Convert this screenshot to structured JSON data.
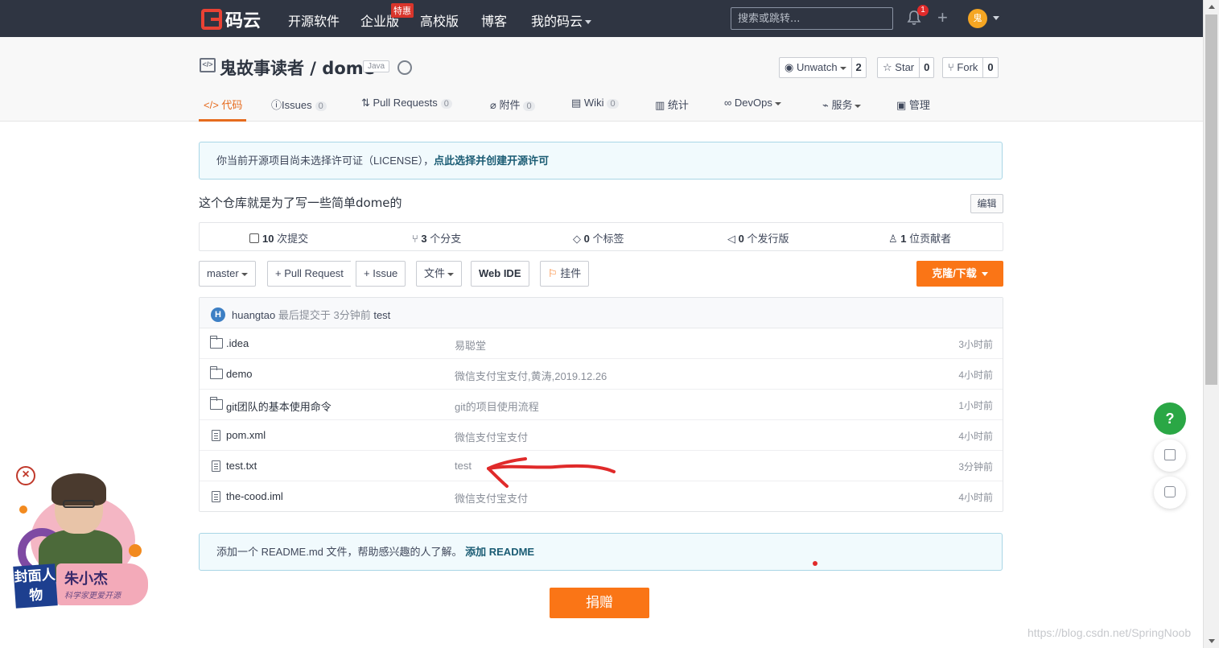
{
  "topbar": {
    "logo_text": "码云",
    "nav": [
      "开源软件",
      "企业版",
      "高校版",
      "博客",
      "我的码云"
    ],
    "promo_badge": "特惠",
    "search_placeholder": "搜索或跳转...",
    "notification_count": "1",
    "avatar_text": "鬼"
  },
  "project": {
    "title": "鬼故事读者 / dome",
    "language": "Java",
    "watch": {
      "label": "Unwatch",
      "count": "2"
    },
    "star": {
      "label": "Star",
      "count": "0"
    },
    "fork": {
      "label": "Fork",
      "count": "0"
    }
  },
  "tabs": [
    {
      "label": "代码",
      "badge": ""
    },
    {
      "label": "Issues",
      "badge": "0"
    },
    {
      "label": "Pull Requests",
      "badge": "0"
    },
    {
      "label": "附件",
      "badge": "0"
    },
    {
      "label": "Wiki",
      "badge": "0"
    },
    {
      "label": "统计",
      "badge": ""
    },
    {
      "label": "DevOps",
      "badge": ""
    },
    {
      "label": "服务",
      "badge": ""
    },
    {
      "label": "管理",
      "badge": ""
    }
  ],
  "license_notice": {
    "text": "你当前开源项目尚未选择许可证（LICENSE），",
    "link": "点此选择并创建开源许可"
  },
  "description": "这个仓库就是为了写一些简单dome的",
  "edit_label": "编辑",
  "stats": [
    {
      "count": "10",
      "label": "次提交"
    },
    {
      "count": "3",
      "label": "个分支"
    },
    {
      "count": "0",
      "label": "个标签"
    },
    {
      "count": "0",
      "label": "个发行版"
    },
    {
      "count": "1",
      "label": "位贡献者"
    }
  ],
  "actions": {
    "branch": "master",
    "pull_request": "+ Pull Request",
    "issue": "+ Issue",
    "file": "文件",
    "web_ide": "Web IDE",
    "widget": "挂件",
    "clone": "克隆/下载"
  },
  "latest_commit": {
    "avatar": "H",
    "author": "huangtao",
    "text": "最后提交于 3分钟前",
    "message": "test"
  },
  "files": [
    {
      "type": "folder",
      "name": ".idea",
      "message": "易聪堂",
      "time": "3小时前"
    },
    {
      "type": "folder",
      "name": "demo",
      "message": "微信支付宝支付,黄涛,2019.12.26",
      "time": "4小时前"
    },
    {
      "type": "folder",
      "name": "git团队的基本使用命令",
      "message": "git的项目使用流程",
      "time": "1小时前"
    },
    {
      "type": "file",
      "name": "pom.xml",
      "message": "微信支付宝支付",
      "time": "4小时前"
    },
    {
      "type": "file",
      "name": "test.txt",
      "message": "test",
      "time": "3分钟前"
    },
    {
      "type": "file",
      "name": "the-cood.iml",
      "message": "微信支付宝支付",
      "time": "4小时前"
    }
  ],
  "readme_notice": {
    "text": "添加一个 README.md 文件，帮助感兴趣的人了解。",
    "link": "添加 README"
  },
  "donate_label": "捐赠",
  "help_label": "?",
  "ad": {
    "close": "×",
    "logo": "封面人物",
    "name": "朱小杰",
    "slogan": "科学家更爱开源"
  },
  "watermark": "https://blog.csdn.net/SpringNoob",
  "colors": {
    "accent": "#fa7516",
    "topbar": "#2f3542",
    "annotation": "#e02a2a"
  }
}
